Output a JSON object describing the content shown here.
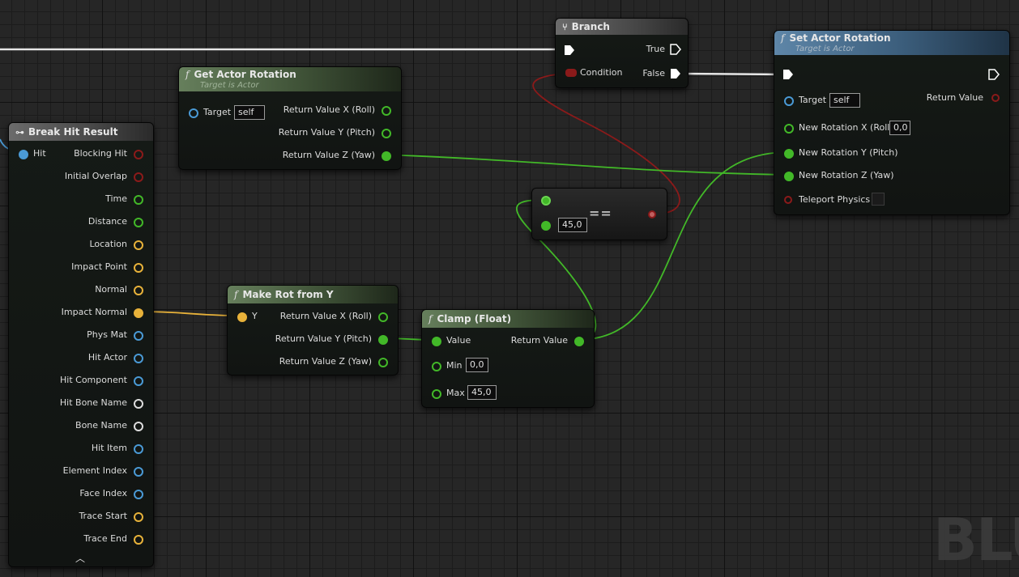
{
  "nodes": {
    "break_hit_result": {
      "title": "Break Hit Result",
      "input_label": "Hit",
      "outputs": [
        {
          "label": "Blocking Hit",
          "color": "red"
        },
        {
          "label": "Initial Overlap",
          "color": "red"
        },
        {
          "label": "Time",
          "color": "green"
        },
        {
          "label": "Distance",
          "color": "green"
        },
        {
          "label": "Location",
          "color": "yellow"
        },
        {
          "label": "Impact Point",
          "color": "yellow"
        },
        {
          "label": "Normal",
          "color": "yellow"
        },
        {
          "label": "Impact Normal",
          "color": "yellow"
        },
        {
          "label": "Phys Mat",
          "color": "blue"
        },
        {
          "label": "Hit Actor",
          "color": "blue"
        },
        {
          "label": "Hit Component",
          "color": "blue"
        },
        {
          "label": "Hit Bone Name",
          "color": "white"
        },
        {
          "label": "Bone Name",
          "color": "white"
        },
        {
          "label": "Hit Item",
          "color": "blue"
        },
        {
          "label": "Element Index",
          "color": "blue"
        },
        {
          "label": "Face Index",
          "color": "blue"
        },
        {
          "label": "Trace Start",
          "color": "yellow"
        },
        {
          "label": "Trace End",
          "color": "yellow"
        }
      ],
      "collapse_icon": "chevron-up-icon"
    },
    "get_actor_rotation": {
      "title": "Get Actor Rotation",
      "subtitle": "Target is Actor",
      "target_label": "Target",
      "target_value": "self",
      "outputs": [
        "Return Value X (Roll)",
        "Return Value Y (Pitch)",
        "Return Value Z (Yaw)"
      ]
    },
    "branch": {
      "title": "Branch",
      "condition_label": "Condition",
      "true_label": "True",
      "false_label": "False"
    },
    "set_actor_rotation": {
      "title": "Set Actor Rotation",
      "subtitle": "Target is Actor",
      "target_label": "Target",
      "target_value": "self",
      "return_label": "Return Value",
      "inputs": [
        {
          "label": "New Rotation X (Roll)",
          "value": "0,0"
        },
        {
          "label": "New Rotation Y (Pitch)",
          "value": ""
        },
        {
          "label": "New Rotation Z (Yaw)",
          "value": ""
        },
        {
          "label": "Teleport Physics",
          "value": ""
        }
      ]
    },
    "equal": {
      "operator": "==",
      "value_b": "45,0"
    },
    "make_rot_from_y": {
      "title": "Make Rot from Y",
      "input_label": "Y",
      "outputs": [
        "Return Value X (Roll)",
        "Return Value Y (Pitch)",
        "Return Value Z (Yaw)"
      ]
    },
    "clamp_float": {
      "title": "Clamp (Float)",
      "value_label": "Value",
      "return_label": "Return Value",
      "min_label": "Min",
      "min_value": "0,0",
      "max_label": "Max",
      "max_value": "45,0"
    }
  },
  "watermark": "BLUEPRINT",
  "colors": {
    "exec": "#ffffff",
    "bool": "#8b1a1a",
    "float": "#42b828",
    "vector": "#e8b23a",
    "object": "#4a9ad6",
    "name": "#dddddd"
  },
  "icons": {
    "function": "function-icon",
    "branch": "branch-icon",
    "break_struct": "break-struct-icon"
  }
}
